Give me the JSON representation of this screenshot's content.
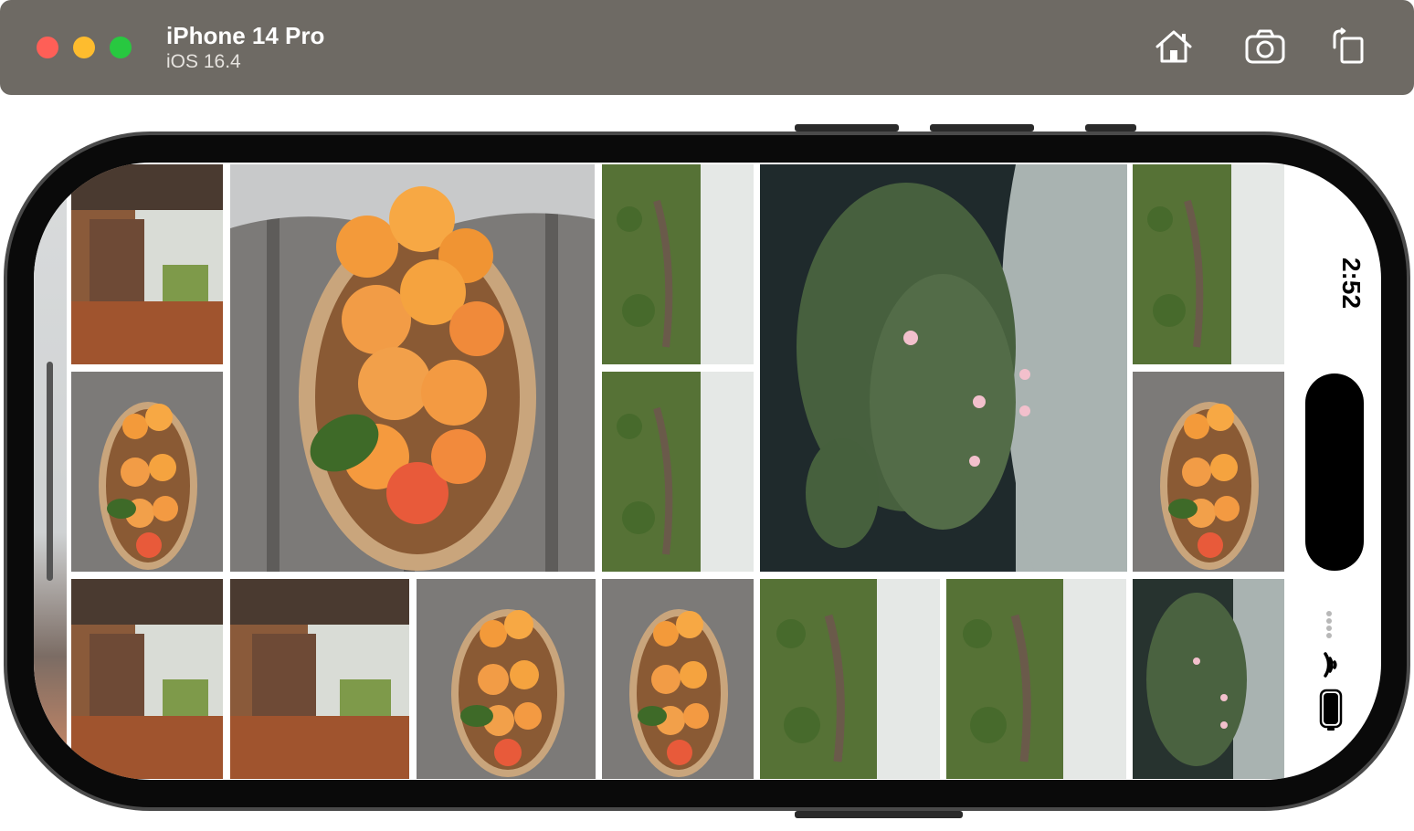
{
  "simulator": {
    "device_name": "iPhone 14 Pro",
    "os_version": "iOS 16.4",
    "toolbar": {
      "home_icon": "home-icon",
      "screenshot_icon": "camera-icon",
      "rotate_icon": "rotate-icon"
    }
  },
  "status_bar": {
    "time": "2:52",
    "icons": [
      "cellular-dots-icon",
      "wifi-icon",
      "battery-icon"
    ]
  },
  "gallery": {
    "photos": [
      "city-street",
      "apricot-basket",
      "green-hillside",
      "water-lilies",
      "green-hillside",
      "apricot-basket",
      "green-hillside",
      "apricot-basket",
      "city-street",
      "city-street",
      "apricot-basket",
      "apricot-basket",
      "green-hillside",
      "green-hillside",
      "water-lilies"
    ]
  },
  "colors": {
    "titlebar": "#6e6a64",
    "close": "#fe5f57",
    "minimize": "#febc2e",
    "zoom": "#28c840"
  }
}
